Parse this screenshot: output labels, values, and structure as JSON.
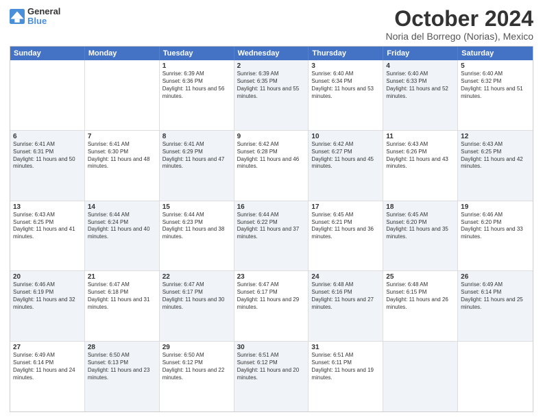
{
  "logo": {
    "line1": "General",
    "line2": "Blue"
  },
  "title": "October 2024",
  "subtitle": "Noria del Borrego (Norias), Mexico",
  "header_days": [
    "Sunday",
    "Monday",
    "Tuesday",
    "Wednesday",
    "Thursday",
    "Friday",
    "Saturday"
  ],
  "rows": [
    [
      {
        "day": "",
        "text": "",
        "shaded": false
      },
      {
        "day": "",
        "text": "",
        "shaded": false
      },
      {
        "day": "1",
        "text": "Sunrise: 6:39 AM\nSunset: 6:36 PM\nDaylight: 11 hours and 56 minutes.",
        "shaded": false
      },
      {
        "day": "2",
        "text": "Sunrise: 6:39 AM\nSunset: 6:35 PM\nDaylight: 11 hours and 55 minutes.",
        "shaded": true
      },
      {
        "day": "3",
        "text": "Sunrise: 6:40 AM\nSunset: 6:34 PM\nDaylight: 11 hours and 53 minutes.",
        "shaded": false
      },
      {
        "day": "4",
        "text": "Sunrise: 6:40 AM\nSunset: 6:33 PM\nDaylight: 11 hours and 52 minutes.",
        "shaded": true
      },
      {
        "day": "5",
        "text": "Sunrise: 6:40 AM\nSunset: 6:32 PM\nDaylight: 11 hours and 51 minutes.",
        "shaded": false
      }
    ],
    [
      {
        "day": "6",
        "text": "Sunrise: 6:41 AM\nSunset: 6:31 PM\nDaylight: 11 hours and 50 minutes.",
        "shaded": true
      },
      {
        "day": "7",
        "text": "Sunrise: 6:41 AM\nSunset: 6:30 PM\nDaylight: 11 hours and 48 minutes.",
        "shaded": false
      },
      {
        "day": "8",
        "text": "Sunrise: 6:41 AM\nSunset: 6:29 PM\nDaylight: 11 hours and 47 minutes.",
        "shaded": true
      },
      {
        "day": "9",
        "text": "Sunrise: 6:42 AM\nSunset: 6:28 PM\nDaylight: 11 hours and 46 minutes.",
        "shaded": false
      },
      {
        "day": "10",
        "text": "Sunrise: 6:42 AM\nSunset: 6:27 PM\nDaylight: 11 hours and 45 minutes.",
        "shaded": true
      },
      {
        "day": "11",
        "text": "Sunrise: 6:43 AM\nSunset: 6:26 PM\nDaylight: 11 hours and 43 minutes.",
        "shaded": false
      },
      {
        "day": "12",
        "text": "Sunrise: 6:43 AM\nSunset: 6:25 PM\nDaylight: 11 hours and 42 minutes.",
        "shaded": true
      }
    ],
    [
      {
        "day": "13",
        "text": "Sunrise: 6:43 AM\nSunset: 6:25 PM\nDaylight: 11 hours and 41 minutes.",
        "shaded": false
      },
      {
        "day": "14",
        "text": "Sunrise: 6:44 AM\nSunset: 6:24 PM\nDaylight: 11 hours and 40 minutes.",
        "shaded": true
      },
      {
        "day": "15",
        "text": "Sunrise: 6:44 AM\nSunset: 6:23 PM\nDaylight: 11 hours and 38 minutes.",
        "shaded": false
      },
      {
        "day": "16",
        "text": "Sunrise: 6:44 AM\nSunset: 6:22 PM\nDaylight: 11 hours and 37 minutes.",
        "shaded": true
      },
      {
        "day": "17",
        "text": "Sunrise: 6:45 AM\nSunset: 6:21 PM\nDaylight: 11 hours and 36 minutes.",
        "shaded": false
      },
      {
        "day": "18",
        "text": "Sunrise: 6:45 AM\nSunset: 6:20 PM\nDaylight: 11 hours and 35 minutes.",
        "shaded": true
      },
      {
        "day": "19",
        "text": "Sunrise: 6:46 AM\nSunset: 6:20 PM\nDaylight: 11 hours and 33 minutes.",
        "shaded": false
      }
    ],
    [
      {
        "day": "20",
        "text": "Sunrise: 6:46 AM\nSunset: 6:19 PM\nDaylight: 11 hours and 32 minutes.",
        "shaded": true
      },
      {
        "day": "21",
        "text": "Sunrise: 6:47 AM\nSunset: 6:18 PM\nDaylight: 11 hours and 31 minutes.",
        "shaded": false
      },
      {
        "day": "22",
        "text": "Sunrise: 6:47 AM\nSunset: 6:17 PM\nDaylight: 11 hours and 30 minutes.",
        "shaded": true
      },
      {
        "day": "23",
        "text": "Sunrise: 6:47 AM\nSunset: 6:17 PM\nDaylight: 11 hours and 29 minutes.",
        "shaded": false
      },
      {
        "day": "24",
        "text": "Sunrise: 6:48 AM\nSunset: 6:16 PM\nDaylight: 11 hours and 27 minutes.",
        "shaded": true
      },
      {
        "day": "25",
        "text": "Sunrise: 6:48 AM\nSunset: 6:15 PM\nDaylight: 11 hours and 26 minutes.",
        "shaded": false
      },
      {
        "day": "26",
        "text": "Sunrise: 6:49 AM\nSunset: 6:14 PM\nDaylight: 11 hours and 25 minutes.",
        "shaded": true
      }
    ],
    [
      {
        "day": "27",
        "text": "Sunrise: 6:49 AM\nSunset: 6:14 PM\nDaylight: 11 hours and 24 minutes.",
        "shaded": false
      },
      {
        "day": "28",
        "text": "Sunrise: 6:50 AM\nSunset: 6:13 PM\nDaylight: 11 hours and 23 minutes.",
        "shaded": true
      },
      {
        "day": "29",
        "text": "Sunrise: 6:50 AM\nSunset: 6:12 PM\nDaylight: 11 hours and 22 minutes.",
        "shaded": false
      },
      {
        "day": "30",
        "text": "Sunrise: 6:51 AM\nSunset: 6:12 PM\nDaylight: 11 hours and 20 minutes.",
        "shaded": true
      },
      {
        "day": "31",
        "text": "Sunrise: 6:51 AM\nSunset: 6:11 PM\nDaylight: 11 hours and 19 minutes.",
        "shaded": false
      },
      {
        "day": "",
        "text": "",
        "shaded": true
      },
      {
        "day": "",
        "text": "",
        "shaded": false
      }
    ]
  ]
}
